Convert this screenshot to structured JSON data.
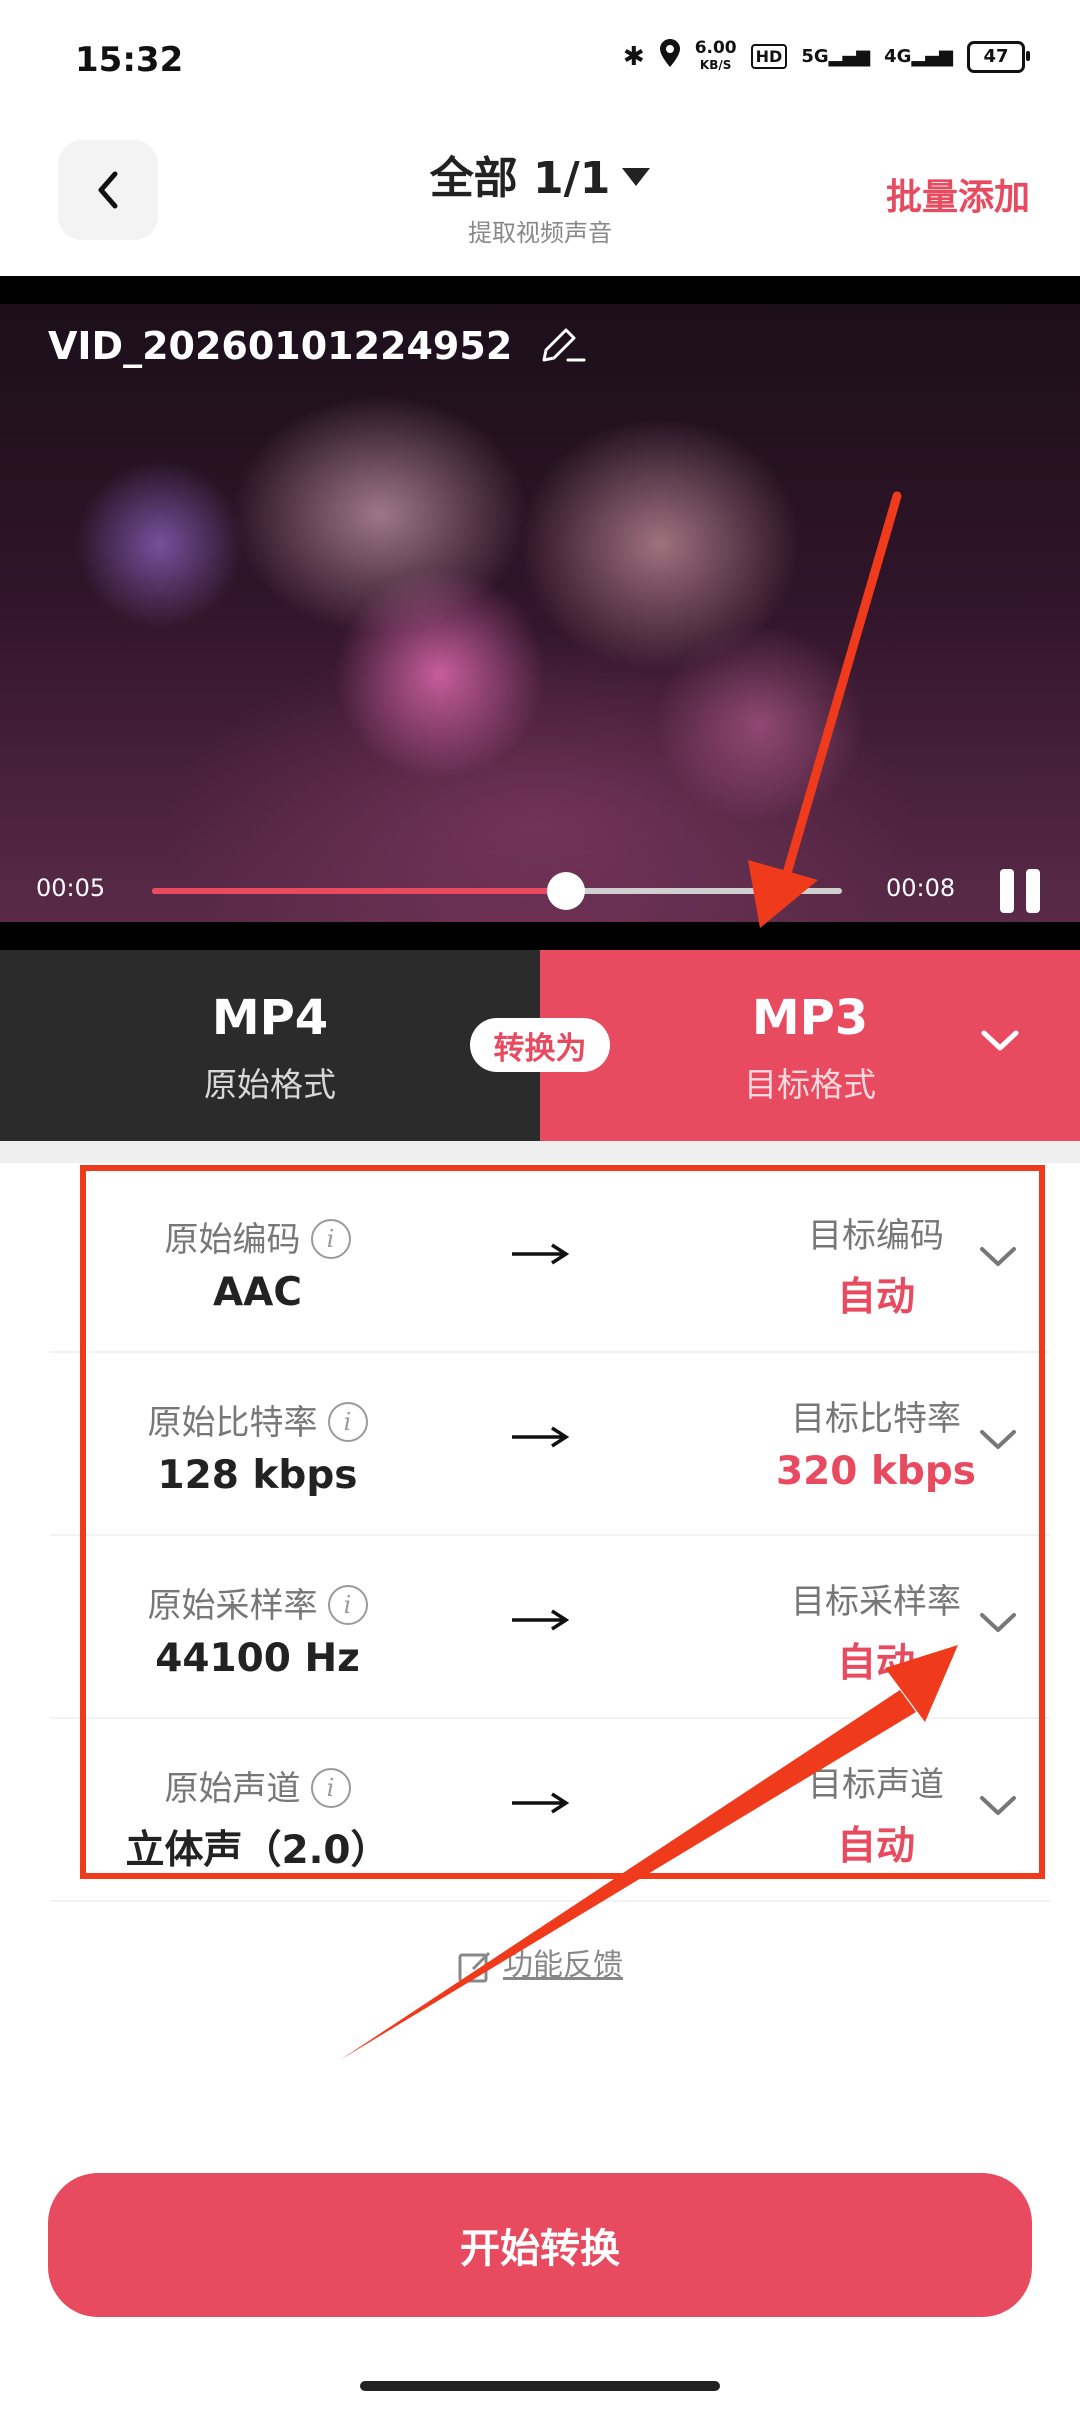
{
  "status_bar": {
    "time": "15:32",
    "net_speed": "6.00",
    "net_speed_unit": "KB/S",
    "hd_badge": "HD",
    "signal_1": "5G",
    "signal_2": "4G",
    "battery": "47"
  },
  "header": {
    "title": "全部 1/1",
    "subtitle": "提取视频声音",
    "batch_add": "批量添加"
  },
  "video": {
    "filename": "VID_20260101224952",
    "current_time": "00:05",
    "duration": "00:08",
    "progress": 0.6
  },
  "format": {
    "source_name": "MP4",
    "source_label": "原始格式",
    "convert_label": "转换为",
    "target_name": "MP3",
    "target_label": "目标格式"
  },
  "params": [
    {
      "orig_label": "原始编码",
      "orig_value": "AAC",
      "target_label": "目标编码",
      "target_value": "自动"
    },
    {
      "orig_label": "原始比特率",
      "orig_value": "128 kbps",
      "target_label": "目标比特率",
      "target_value": "320 kbps"
    },
    {
      "orig_label": "原始采样率",
      "orig_value": "44100 Hz",
      "target_label": "目标采样率",
      "target_value": "自动"
    },
    {
      "orig_label": "原始声道",
      "orig_value": "立体声（2.0）",
      "target_label": "目标声道",
      "target_value": "自动"
    }
  ],
  "feedback": "功能反馈",
  "start_button": "开始转换",
  "colors": {
    "accent": "#e84a5f",
    "annotation": "#f03a1c"
  }
}
